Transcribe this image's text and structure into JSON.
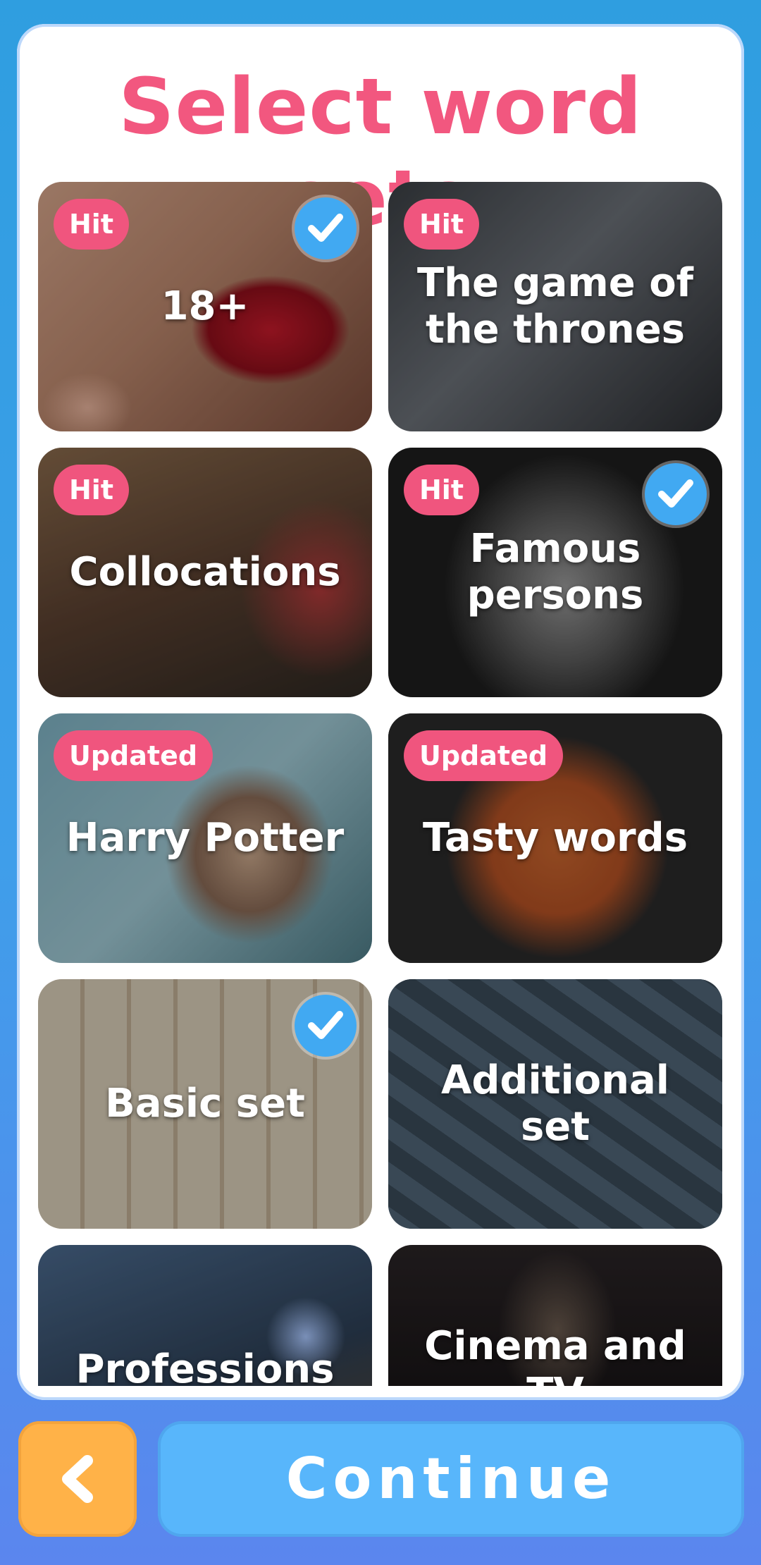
{
  "header": {
    "title": "Select word sets"
  },
  "cards": [
    {
      "label": "18+",
      "badge": "Hit",
      "selected": true
    },
    {
      "label": "The game of the thrones",
      "badge": "Hit",
      "selected": false
    },
    {
      "label": "Collocations",
      "badge": "Hit",
      "selected": false
    },
    {
      "label": "Famous persons",
      "badge": "Hit",
      "selected": true
    },
    {
      "label": "Harry Potter",
      "badge": "Updated",
      "selected": false
    },
    {
      "label": "Tasty words",
      "badge": "Updated",
      "selected": false
    },
    {
      "label": "Basic set",
      "badge": "",
      "selected": true
    },
    {
      "label": "Additional set",
      "badge": "",
      "selected": false
    },
    {
      "label": "Professions",
      "badge": "",
      "selected": false
    },
    {
      "label": "Cinema and TV",
      "badge": "",
      "selected": false
    }
  ],
  "footer": {
    "continue_label": "Continue",
    "back_icon": "chevron-left-icon"
  },
  "colors": {
    "accent_pink": "#f2577f",
    "check_blue": "#41a9f2",
    "continue_blue": "#58b6fb",
    "back_orange": "#ffb248"
  }
}
